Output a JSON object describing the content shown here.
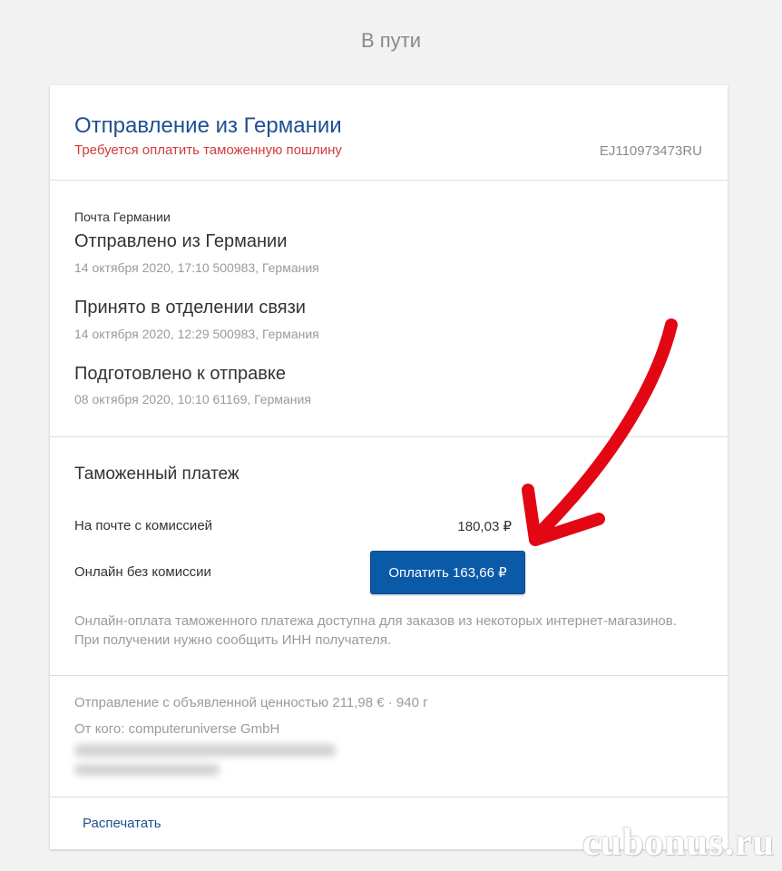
{
  "page": {
    "status_title": "В пути"
  },
  "header": {
    "title": "Отправление из Германии",
    "warning": "Требуется оплатить таможенную пошлину",
    "tracking_number": "EJ110973473RU"
  },
  "history": {
    "carrier": "Почта Германии",
    "events": [
      {
        "title": "Отправлено из Германии",
        "meta": "14 октября 2020, 17:10 500983, Германия"
      },
      {
        "title": "Принято в отделении связи",
        "meta": "14 октября 2020, 12:29 500983, Германия"
      },
      {
        "title": "Подготовлено к отправке",
        "meta": "08 октября 2020, 10:10 61169, Германия"
      }
    ]
  },
  "customs": {
    "heading": "Таможенный платеж",
    "post_label": "На почте с комиссией",
    "post_value": "180,03 ₽",
    "online_label": "Онлайн без комиссии",
    "pay_button": "Оплатить 163,66 ₽",
    "note": "Онлайн-оплата таможенного платежа доступна для заказов из некоторых интернет-магазинов. При получении нужно сообщить ИНН получателя."
  },
  "details": {
    "declared": "Отправление с объявленной ценностью 211,98 € · 940 г",
    "sender": "От кого: computeruniverse GmbH"
  },
  "footer": {
    "print_link": "Распечатать"
  },
  "watermark": "cubonus.ru",
  "colors": {
    "accent": "#1f4f91",
    "button": "#0b5aa8",
    "warning": "#d23b3b",
    "annotation_arrow": "#e30613"
  }
}
